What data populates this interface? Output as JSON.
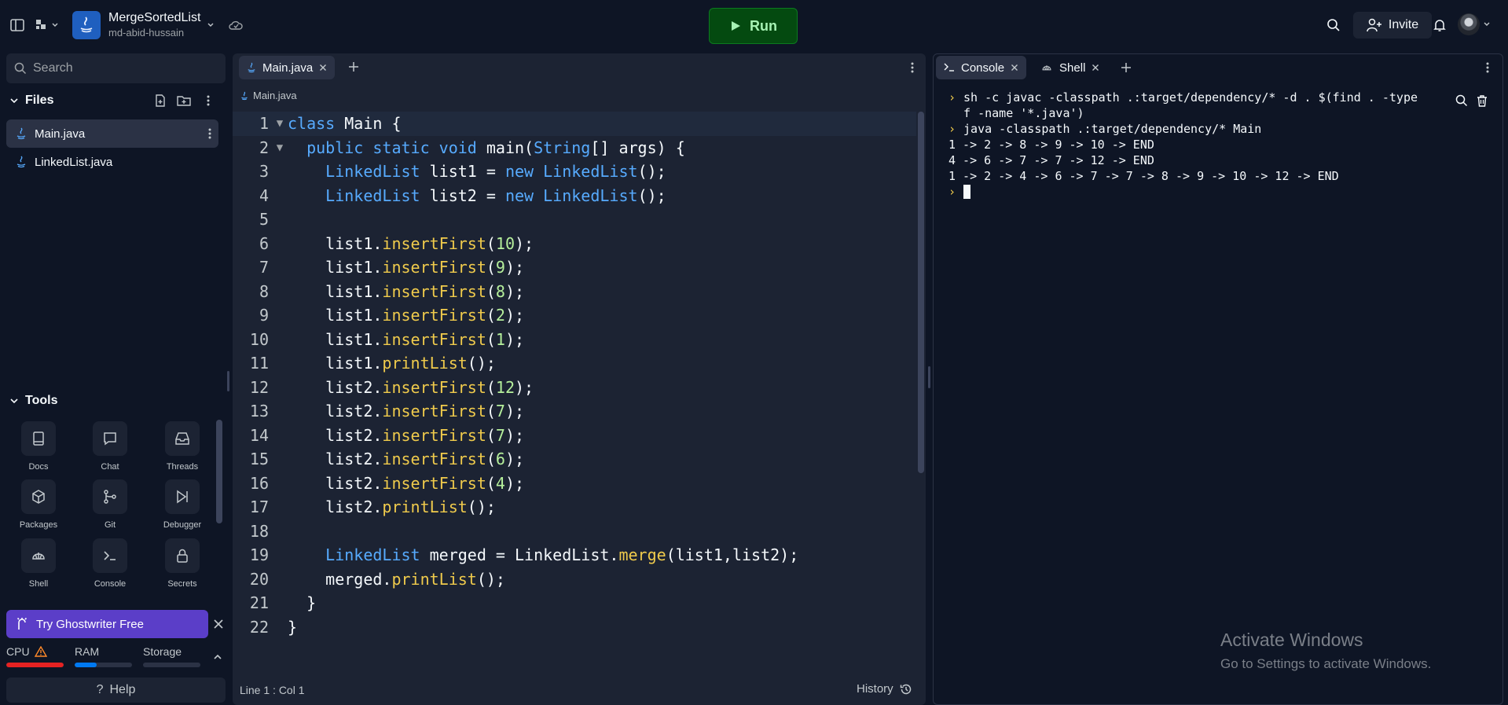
{
  "project": {
    "name": "MergeSortedList",
    "owner": "md-abid-hussain"
  },
  "header": {
    "run_label": "Run",
    "invite_label": "Invite"
  },
  "sidebar": {
    "search_placeholder": "Search",
    "files_title": "Files",
    "files": [
      {
        "name": "Main.java",
        "active": true
      },
      {
        "name": "LinkedList.java",
        "active": false
      }
    ],
    "tools_title": "Tools",
    "tools": [
      {
        "label": "Docs",
        "icon": "book-icon"
      },
      {
        "label": "Chat",
        "icon": "chat-icon"
      },
      {
        "label": "Threads",
        "icon": "inbox-icon"
      },
      {
        "label": "Packages",
        "icon": "package-icon"
      },
      {
        "label": "Git",
        "icon": "git-icon"
      },
      {
        "label": "Debugger",
        "icon": "debugger-icon"
      },
      {
        "label": "Shell",
        "icon": "shell-icon"
      },
      {
        "label": "Console",
        "icon": "terminal-icon"
      },
      {
        "label": "Secrets",
        "icon": "lock-icon"
      }
    ],
    "ghostwriter_label": "Try Ghostwriter Free",
    "resources": [
      {
        "label": "CPU",
        "level": 1.0,
        "color": "#e52222",
        "warning": true
      },
      {
        "label": "RAM",
        "level": 0.38,
        "color": "#0079f2",
        "warning": false
      },
      {
        "label": "Storage",
        "level": 0.0,
        "color": "#2b3245",
        "warning": false
      }
    ],
    "help_label": "Help"
  },
  "editor": {
    "tab_label": "Main.java",
    "breadcrumb": "Main.java",
    "cursor_position": "Line 1 : Col 1",
    "history_label": "History",
    "lines": [
      [
        [
          "k",
          "class"
        ],
        [
          "c",
          " Main {"
        ]
      ],
      [
        [
          "c",
          "  "
        ],
        [
          "k",
          "public static void"
        ],
        [
          "c",
          " main("
        ],
        [
          "t",
          "String"
        ],
        [
          "c",
          "[] args) {"
        ]
      ],
      [
        [
          "c",
          "    "
        ],
        [
          "t",
          "LinkedList"
        ],
        [
          "c",
          " list1 = "
        ],
        [
          "k",
          "new"
        ],
        [
          "c",
          " "
        ],
        [
          "t",
          "LinkedList"
        ],
        [
          "c",
          "();"
        ]
      ],
      [
        [
          "c",
          "    "
        ],
        [
          "t",
          "LinkedList"
        ],
        [
          "c",
          " list2 = "
        ],
        [
          "k",
          "new"
        ],
        [
          "c",
          " "
        ],
        [
          "t",
          "LinkedList"
        ],
        [
          "c",
          "();"
        ]
      ],
      [],
      [
        [
          "c",
          "    list1."
        ],
        [
          "m",
          "insertFirst"
        ],
        [
          "c",
          "("
        ],
        [
          "n",
          "10"
        ],
        [
          "c",
          ");"
        ]
      ],
      [
        [
          "c",
          "    list1."
        ],
        [
          "m",
          "insertFirst"
        ],
        [
          "c",
          "("
        ],
        [
          "n",
          "9"
        ],
        [
          "c",
          ");"
        ]
      ],
      [
        [
          "c",
          "    list1."
        ],
        [
          "m",
          "insertFirst"
        ],
        [
          "c",
          "("
        ],
        [
          "n",
          "8"
        ],
        [
          "c",
          ");"
        ]
      ],
      [
        [
          "c",
          "    list1."
        ],
        [
          "m",
          "insertFirst"
        ],
        [
          "c",
          "("
        ],
        [
          "n",
          "2"
        ],
        [
          "c",
          ");"
        ]
      ],
      [
        [
          "c",
          "    list1."
        ],
        [
          "m",
          "insertFirst"
        ],
        [
          "c",
          "("
        ],
        [
          "n",
          "1"
        ],
        [
          "c",
          ");"
        ]
      ],
      [
        [
          "c",
          "    list1."
        ],
        [
          "m",
          "printList"
        ],
        [
          "c",
          "();"
        ]
      ],
      [
        [
          "c",
          "    list2."
        ],
        [
          "m",
          "insertFirst"
        ],
        [
          "c",
          "("
        ],
        [
          "n",
          "12"
        ],
        [
          "c",
          ");"
        ]
      ],
      [
        [
          "c",
          "    list2."
        ],
        [
          "m",
          "insertFirst"
        ],
        [
          "c",
          "("
        ],
        [
          "n",
          "7"
        ],
        [
          "c",
          ");"
        ]
      ],
      [
        [
          "c",
          "    list2."
        ],
        [
          "m",
          "insertFirst"
        ],
        [
          "c",
          "("
        ],
        [
          "n",
          "7"
        ],
        [
          "c",
          ");"
        ]
      ],
      [
        [
          "c",
          "    list2."
        ],
        [
          "m",
          "insertFirst"
        ],
        [
          "c",
          "("
        ],
        [
          "n",
          "6"
        ],
        [
          "c",
          ");"
        ]
      ],
      [
        [
          "c",
          "    list2."
        ],
        [
          "m",
          "insertFirst"
        ],
        [
          "c",
          "("
        ],
        [
          "n",
          "4"
        ],
        [
          "c",
          ");"
        ]
      ],
      [
        [
          "c",
          "    list2."
        ],
        [
          "m",
          "printList"
        ],
        [
          "c",
          "();"
        ]
      ],
      [],
      [
        [
          "c",
          "    "
        ],
        [
          "t",
          "LinkedList"
        ],
        [
          "c",
          " merged = LinkedList."
        ],
        [
          "m",
          "merge"
        ],
        [
          "c",
          "(list1,list2);"
        ]
      ],
      [
        [
          "c",
          "    merged."
        ],
        [
          "m",
          "printList"
        ],
        [
          "c",
          "();"
        ]
      ],
      [
        [
          "c",
          "  }"
        ]
      ],
      [
        [
          "c",
          "}"
        ]
      ]
    ]
  },
  "console": {
    "tabs": [
      "Console",
      "Shell"
    ],
    "commands": [
      "sh -c javac -classpath .:target/dependency/* -d . $(find . -type f -name '*.java')",
      "java -classpath .:target/dependency/* Main"
    ],
    "output": [
      "1 -> 2 -> 8 -> 9 -> 10 -> END",
      "4 -> 6 -> 7 -> 7 -> 12 -> END",
      "1 -> 2 -> 4 -> 6 -> 7 -> 7 -> 8 -> 9 -> 10 -> 12 -> END"
    ]
  },
  "watermark": {
    "title": "Activate Windows",
    "subtitle": "Go to Settings to activate Windows."
  }
}
